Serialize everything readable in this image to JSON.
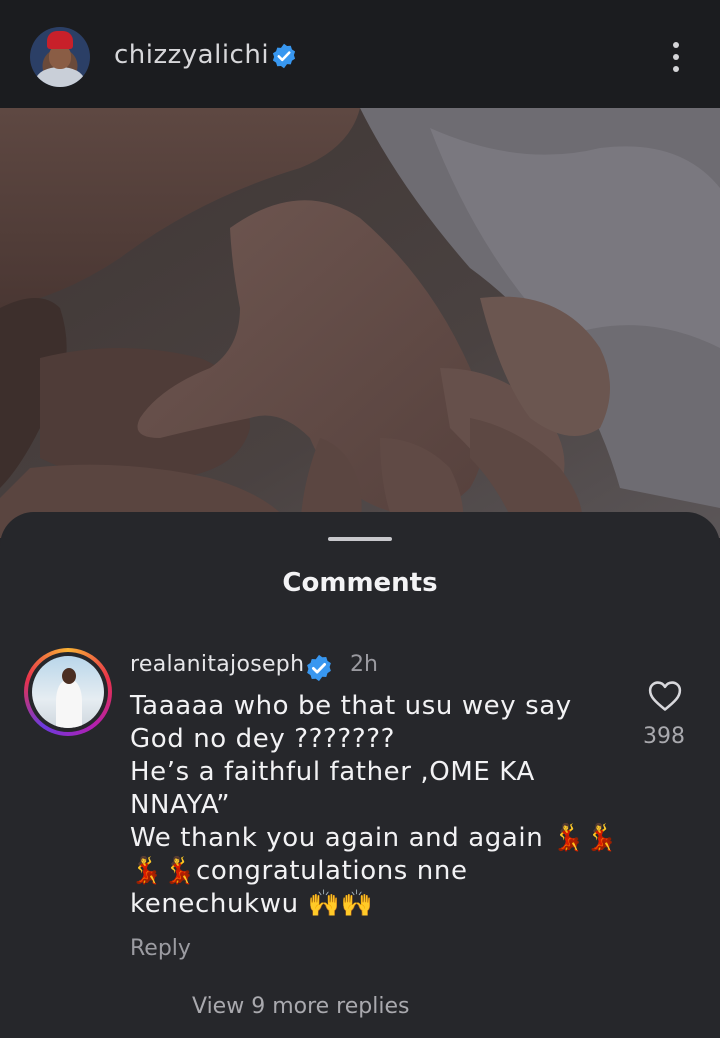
{
  "header": {
    "username": "chizzyalichi",
    "verified_icon": "verified-badge-icon",
    "menu_icon": "more-vertical-icon"
  },
  "post": {
    "image_alt_icon": "baby-hand-photo"
  },
  "comments_sheet": {
    "title": "Comments",
    "comment": {
      "username": "realanitajoseph",
      "time": "2h",
      "text": "Taaaaa who be that usu wey say God no dey ???????\nHe’s a faithful father ,OME KA NNAYA”\nWe thank you again and again 💃💃💃💃congratulations nne kenechukwu 🙌🙌",
      "likes": "398",
      "reply_label": "Reply",
      "view_replies_label": "View 9 more replies"
    }
  },
  "colors": {
    "background": "#26272b",
    "topbar": "#1b1c1f",
    "verified": "#3897f0",
    "muted_text": "#9c9ca2"
  }
}
